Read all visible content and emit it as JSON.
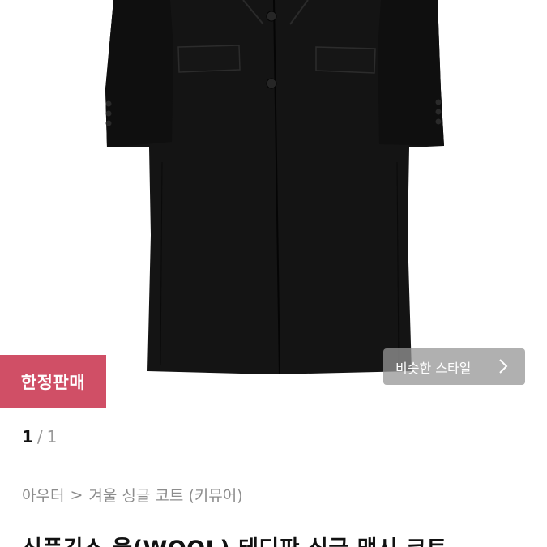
{
  "product": {
    "badge_label": "한정판매",
    "similar_style_label": "비슷한 스타일",
    "pager": {
      "current": "1",
      "separator": "/",
      "total": "1"
    },
    "breadcrumb": {
      "category": "아우터",
      "separator": ">",
      "subcategory": "겨울 싱글 코트 (키뮤어)"
    },
    "title": "신풍긴스 울(WOOL) 테디판 싱글 맥시 코트"
  },
  "colors": {
    "badge_bg": "#d04f66",
    "coat": "#121212",
    "similar_button_bg": "#969696"
  },
  "icons": {
    "coat_image": "black-wool-long-coat-photo",
    "similar_arrow": "chevron-right-icon"
  }
}
